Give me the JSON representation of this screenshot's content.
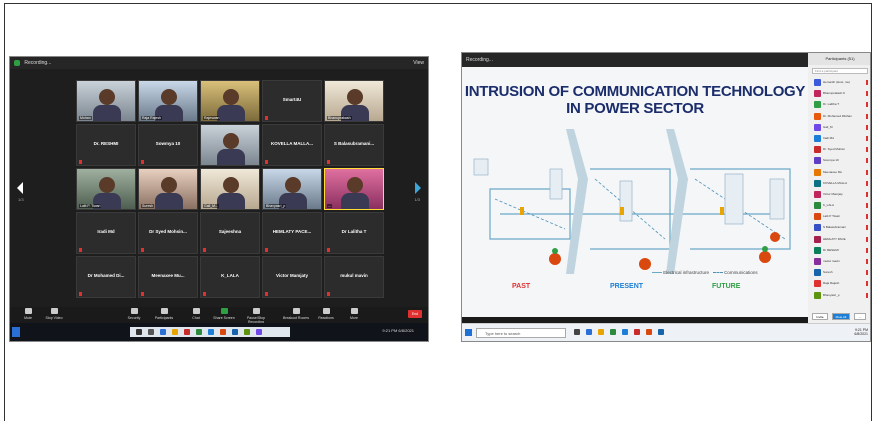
{
  "left_window": {
    "recording_label": "Recording...",
    "view_label": "View",
    "page_left": "1/3",
    "page_right": "1/3",
    "tiles": [
      {
        "name": "",
        "label": "Mohan",
        "kind": "video v2"
      },
      {
        "name": "",
        "label": "Raja Rajesh",
        "kind": "video v8"
      },
      {
        "name": "",
        "label": "Rajeswari",
        "kind": "video v3"
      },
      {
        "name": "Smart4U",
        "label": "",
        "kind": "name"
      },
      {
        "name": "",
        "label": "Bhanuprakash",
        "kind": "video v4"
      },
      {
        "name": "Dr. RESHMI",
        "label": "",
        "kind": "name"
      },
      {
        "name": "Sowmya 10",
        "label": "",
        "kind": "name"
      },
      {
        "name": "",
        "label": "",
        "kind": "video v2"
      },
      {
        "name": "KOVELLA MALLA...",
        "label": "",
        "kind": "name"
      },
      {
        "name": "S Balasubramani...",
        "label": "",
        "kind": "name"
      },
      {
        "name": "",
        "label": "Lalit P. Tiwari",
        "kind": "video v5"
      },
      {
        "name": "",
        "label": "Suresh",
        "kind": "video v6"
      },
      {
        "name": "",
        "label": "Gali_M...",
        "kind": "video v4"
      },
      {
        "name": "",
        "label": "Bhavyasri_p",
        "kind": "video v8"
      },
      {
        "name": "",
        "label": "...",
        "kind": "video v7"
      },
      {
        "name": "Iradi Md",
        "label": "",
        "kind": "name"
      },
      {
        "name": "Dr Syed Mohsin...",
        "label": "",
        "kind": "name"
      },
      {
        "name": "Sajeeshna",
        "label": "",
        "kind": "name"
      },
      {
        "name": "HEMLATY PACE...",
        "label": "",
        "kind": "name"
      },
      {
        "name": "Dr Lalitha T",
        "label": "",
        "kind": "name"
      },
      {
        "name": "Dr Mohamed Di...",
        "label": "",
        "kind": "name"
      },
      {
        "name": "Meenaxee Mu...",
        "label": "",
        "kind": "name"
      },
      {
        "name": "K_LALA",
        "label": "",
        "kind": "name"
      },
      {
        "name": "Victor Mamjaty",
        "label": "",
        "kind": "name"
      },
      {
        "name": "mukul mavin",
        "label": "",
        "kind": "name"
      }
    ],
    "controls": {
      "mute": "Mute",
      "stop_video": "Stop Video",
      "security": "Security",
      "participants": "Participants",
      "participants_count": "51",
      "chat": "Chat",
      "share_screen": "Share Screen",
      "pause_recording": "Pause/Stop Recording",
      "breakout_rooms": "Breakout Rooms",
      "reactions": "Reactions",
      "more": "More",
      "end": "End"
    },
    "taskbar_time": "9:21 PM",
    "taskbar_date": "6/8/2021"
  },
  "right_window": {
    "recording_label": "Recording...",
    "slide_title_line1": "INTRUSION OF COMMUNICATION TECHNOLOGY",
    "slide_title_line2": "IN POWER SECTOR",
    "era_past": "PAST",
    "era_present": "PRESENT",
    "era_future": "FUTURE",
    "legend_electrical": "Electrical infrastructure",
    "legend_communications": "Communications",
    "panel_title": "Participants (51)",
    "panel_search": "Find a participant",
    "participants": [
      {
        "name": "Hemanth (Host, me)",
        "color": "#3b5bdb"
      },
      {
        "name": "Bhanuprakash K",
        "color": "#c2255c"
      },
      {
        "name": "Dr. Lalitha T",
        "color": "#2f9e44"
      },
      {
        "name": "Dr. Mohamed Dilshan",
        "color": "#e8590c"
      },
      {
        "name": "Gali_M",
        "color": "#7048e8"
      },
      {
        "name": "Iradi Md",
        "color": "#1c7ed6"
      },
      {
        "name": "Dr. Syed Mohsin",
        "color": "#c92a2a"
      },
      {
        "name": "Sowmya 10",
        "color": "#5f3dc4"
      },
      {
        "name": "Meenaxee Mu",
        "color": "#e67700"
      },
      {
        "name": "KOVELLA MALLA",
        "color": "#0b7285"
      },
      {
        "name": "Victor Mamjaty",
        "color": "#c2255c"
      },
      {
        "name": "K_LALA",
        "color": "#2b8a3e"
      },
      {
        "name": "Lalit P Tiwari",
        "color": "#d9480f"
      },
      {
        "name": "S Balasubramani",
        "color": "#364fc7"
      },
      {
        "name": "HEMLATY PACE",
        "color": "#a61e4d"
      },
      {
        "name": "Dr RESHMI",
        "color": "#087f5b"
      },
      {
        "name": "mukul mavin",
        "color": "#862e9c"
      },
      {
        "name": "Suresh",
        "color": "#1864ab"
      },
      {
        "name": "Raja Rajesh",
        "color": "#e03131"
      },
      {
        "name": "Bhavyasri_p",
        "color": "#5c940d"
      }
    ],
    "panel_invite": "Invite",
    "panel_mute_all": "Mute All",
    "panel_more": "...",
    "taskbar_search": "Type here to search",
    "taskbar_time": "9:21 PM",
    "taskbar_date": "6/8/2021"
  }
}
